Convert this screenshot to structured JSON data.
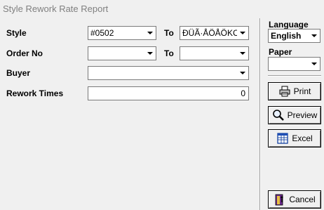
{
  "window": {
    "title": "Style Rework Rate Report"
  },
  "form": {
    "style": {
      "label": "Style",
      "from_value": "#0502",
      "to_label": "To",
      "to_value": "ÐÜÃ·ÅÖÅÖKC"
    },
    "order_no": {
      "label": "Order No",
      "from_value": "",
      "to_label": "To",
      "to_value": ""
    },
    "buyer": {
      "label": "Buyer",
      "value": ""
    },
    "rework_times": {
      "label": "Rework Times",
      "value": "0"
    }
  },
  "side": {
    "language_label": "Language",
    "language_value": "English",
    "paper_label": "Paper",
    "paper_value": ""
  },
  "buttons": {
    "print": "Print",
    "preview": "Preview",
    "excel": "Excel",
    "cancel": "Cancel"
  },
  "icons": {
    "print": "printer-icon",
    "preview": "magnifier-icon",
    "excel": "spreadsheet-icon",
    "cancel": "exit-door-icon"
  }
}
